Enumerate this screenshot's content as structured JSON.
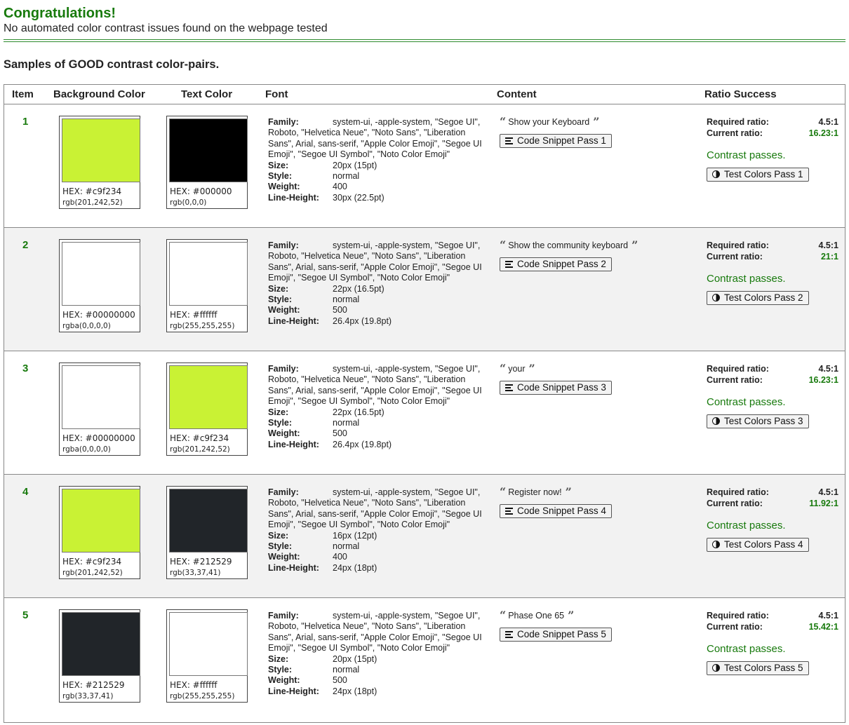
{
  "header": {
    "title": "Congratulations!",
    "subtitle": "No automated color contrast issues found on the webpage tested"
  },
  "samples_title": "Samples of GOOD contrast color-pairs.",
  "columns": {
    "item": "Item",
    "background": "Background Color",
    "text": "Text Color",
    "font": "Font",
    "content": "Content",
    "ratio": "Ratio Success"
  },
  "labels": {
    "family": "Family:",
    "size": "Size:",
    "style": "Style:",
    "weight": "Weight:",
    "line_height": "Line-Height:",
    "required": "Required ratio:",
    "current": "Current ratio:",
    "passes": "Contrast passes."
  },
  "rows": [
    {
      "item": "1",
      "bg": {
        "hex_label": "HEX: #c9f234",
        "rgb": "rgb(201,242,52)",
        "color": "#c9f234"
      },
      "fg": {
        "hex_label": "HEX: #000000",
        "rgb": "rgb(0,0,0)",
        "color": "#000000"
      },
      "family": "system-ui, -apple-system, \"Segoe UI\", Roboto, \"Helvetica Neue\", \"Noto Sans\", \"Liberation Sans\", Arial, sans-serif, \"Apple Color Emoji\", \"Segoe UI Emoji\", \"Segoe UI Symbol\", \"Noto Color Emoji\"",
      "size": "20px (15pt)",
      "style": "normal",
      "weight": "400",
      "line_height": "30px (22.5pt)",
      "quote": "Show your Keyboard",
      "snippet_button": "Code Snippet Pass 1",
      "required": "4.5:1",
      "current": "16.23:1",
      "test_button": "Test Colors Pass 1"
    },
    {
      "item": "2",
      "bg": {
        "hex_label": "HEX: #00000000",
        "rgb": "rgba(0,0,0,0)",
        "color": "#ffffff"
      },
      "fg": {
        "hex_label": "HEX: #ffffff",
        "rgb": "rgb(255,255,255)",
        "color": "#ffffff"
      },
      "family": "system-ui, -apple-system, \"Segoe UI\", Roboto, \"Helvetica Neue\", \"Noto Sans\", \"Liberation Sans\", Arial, sans-serif, \"Apple Color Emoji\", \"Segoe UI Emoji\", \"Segoe UI Symbol\", \"Noto Color Emoji\"",
      "size": "22px (16.5pt)",
      "style": "normal",
      "weight": "500",
      "line_height": "26.4px (19.8pt)",
      "quote": "Show the community keyboard",
      "snippet_button": "Code Snippet Pass 2",
      "required": "4.5:1",
      "current": "21:1",
      "test_button": "Test Colors Pass 2"
    },
    {
      "item": "3",
      "bg": {
        "hex_label": "HEX: #00000000",
        "rgb": "rgba(0,0,0,0)",
        "color": "#ffffff"
      },
      "fg": {
        "hex_label": "HEX: #c9f234",
        "rgb": "rgb(201,242,52)",
        "color": "#c9f234"
      },
      "family": "system-ui, -apple-system, \"Segoe UI\", Roboto, \"Helvetica Neue\", \"Noto Sans\", \"Liberation Sans\", Arial, sans-serif, \"Apple Color Emoji\", \"Segoe UI Emoji\", \"Segoe UI Symbol\", \"Noto Color Emoji\"",
      "size": "22px (16.5pt)",
      "style": "normal",
      "weight": "500",
      "line_height": "26.4px (19.8pt)",
      "quote": "your",
      "snippet_button": "Code Snippet Pass 3",
      "required": "4.5:1",
      "current": "16.23:1",
      "test_button": "Test Colors Pass 3"
    },
    {
      "item": "4",
      "bg": {
        "hex_label": "HEX: #c9f234",
        "rgb": "rgb(201,242,52)",
        "color": "#c9f234"
      },
      "fg": {
        "hex_label": "HEX: #212529",
        "rgb": "rgb(33,37,41)",
        "color": "#212529"
      },
      "family": "system-ui, -apple-system, \"Segoe UI\", Roboto, \"Helvetica Neue\", \"Noto Sans\", \"Liberation Sans\", Arial, sans-serif, \"Apple Color Emoji\", \"Segoe UI Emoji\", \"Segoe UI Symbol\", \"Noto Color Emoji\"",
      "size": "16px (12pt)",
      "style": "normal",
      "weight": "400",
      "line_height": "24px (18pt)",
      "quote": "Register now!",
      "snippet_button": "Code Snippet Pass 4",
      "required": "4.5:1",
      "current": "11.92:1",
      "test_button": "Test Colors Pass 4"
    },
    {
      "item": "5",
      "bg": {
        "hex_label": "HEX: #212529",
        "rgb": "rgb(33,37,41)",
        "color": "#212529"
      },
      "fg": {
        "hex_label": "HEX: #ffffff",
        "rgb": "rgb(255,255,255)",
        "color": "#ffffff"
      },
      "family": "system-ui, -apple-system, \"Segoe UI\", Roboto, \"Helvetica Neue\", \"Noto Sans\", \"Liberation Sans\", Arial, sans-serif, \"Apple Color Emoji\", \"Segoe UI Emoji\", \"Segoe UI Symbol\", \"Noto Color Emoji\"",
      "size": "20px (15pt)",
      "style": "normal",
      "weight": "500",
      "line_height": "24px (18pt)",
      "quote": "Phase One 65",
      "snippet_button": "Code Snippet Pass 5",
      "required": "4.5:1",
      "current": "15.42:1",
      "test_button": "Test Colors Pass 5"
    }
  ],
  "colors": {
    "success_green": "#187a0d",
    "alt_row_bg": "#f2f2f2"
  }
}
